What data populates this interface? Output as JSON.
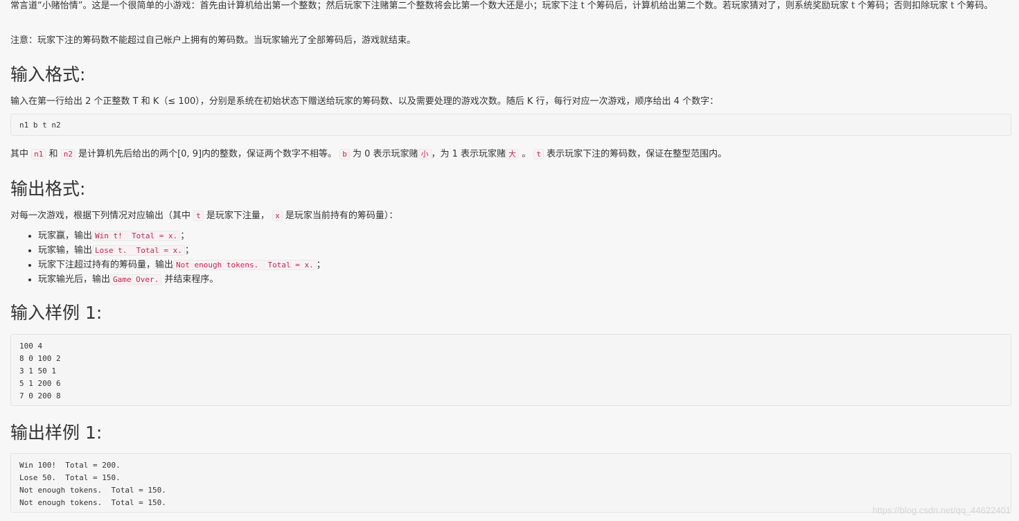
{
  "intro": {
    "text": "常言道“小赌怡情”。这是一个很简单的小游戏：首先由计算机给出第一个整数；然后玩家下注赌第二个整数将会比第一个数大还是小；玩家下注 t 个筹码后，计算机给出第二个数。若玩家猜对了，则系统奖励玩家 t 个筹码；否则扣除玩家 t 个筹码。"
  },
  "note": {
    "text": "注意：玩家下注的筹码数不能超过自己帐户上拥有的筹码数。当玩家输光了全部筹码后，游戏就结束。"
  },
  "input_format": {
    "heading": "输入格式:",
    "text": "输入在第一行给出 2 个正整数 T 和 K（≤ 100），分别是系统在初始状态下赠送给玩家的筹码数、以及需要处理的游戏次数。随后 K 行，每行对应一次游戏，顺序给出 4 个数字：",
    "code_block": "n1 b t n2",
    "desc": {
      "p1": "其中",
      "c1": "n1",
      "p2": "和",
      "c2": "n2",
      "p3": "是计算机先后给出的两个[0, 9]内的整数，保证两个数字不相等。",
      "c3": "b",
      "p4": "为 0 表示玩家赌",
      "c4": "小",
      "p5": "，为 1 表示玩家赌",
      "c5": "大",
      "p6": "。",
      "c6": "t",
      "p7": "表示玩家下注的筹码数，保证在整型范围内。"
    }
  },
  "output_format": {
    "heading": "输出格式:",
    "desc": {
      "p1": "对每一次游戏，根据下列情况对应输出（其中",
      "c1": "t",
      "p2": "是玩家下注量，",
      "c2": "x",
      "p3": "是玩家当前持有的筹码量）："
    },
    "items": [
      {
        "prefix": "玩家赢，输出",
        "code": "Win t!  Total = x.",
        "suffix": "；"
      },
      {
        "prefix": "玩家输，输出",
        "code": "Lose t.  Total = x.",
        "suffix": "；"
      },
      {
        "prefix": "玩家下注超过持有的筹码量，输出",
        "code": "Not enough tokens.  Total = x.",
        "suffix": "；"
      },
      {
        "prefix": "玩家输光后，输出",
        "code": "Game Over.",
        "suffix": "并结束程序。"
      }
    ]
  },
  "sample_input": {
    "heading": "输入样例 1:",
    "code_block": "100 4\n8 0 100 2\n3 1 50 1\n5 1 200 6\n7 0 200 8"
  },
  "sample_output": {
    "heading": "输出样例 1:",
    "code_block": "Win 100!  Total = 200.\nLose 50.  Total = 150.\nNot enough tokens.  Total = 150.\nNot enough tokens.  Total = 150."
  },
  "watermark": "https://blog.csdn.net/qq_44622401"
}
